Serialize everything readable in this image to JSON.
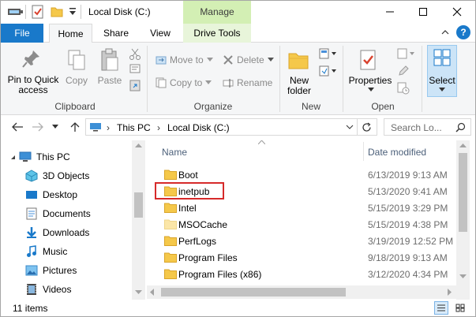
{
  "window": {
    "title": "Local Disk (C:)",
    "context_tab": "Manage",
    "minimize_glyph": "—",
    "maximize_glyph": "☐",
    "close_glyph": "✕"
  },
  "ribbon_tabs": [
    "File",
    "Home",
    "Share",
    "View",
    "Drive Tools"
  ],
  "help_glyph": "?",
  "clipboard": {
    "pin_label_1": "Pin to Quick",
    "pin_label_2": "access",
    "copy": "Copy",
    "paste": "Paste",
    "group": "Clipboard"
  },
  "organize": {
    "move_to": "Move to",
    "copy_to": "Copy to",
    "delete": "Delete",
    "rename": "Rename",
    "group": "Organize"
  },
  "new": {
    "new_folder_1": "New",
    "new_folder_2": "folder",
    "group": "New"
  },
  "open": {
    "properties": "Properties",
    "group": "Open"
  },
  "select": {
    "label": "Select"
  },
  "address": {
    "crumbs": [
      "This PC",
      "Local Disk (C:)"
    ],
    "search_placeholder": "Search Lo..."
  },
  "nav_pane": [
    {
      "label": "This PC",
      "icon": "this-pc-icon"
    },
    {
      "label": "3D Objects",
      "icon": "3d-objects-icon"
    },
    {
      "label": "Desktop",
      "icon": "desktop-icon"
    },
    {
      "label": "Documents",
      "icon": "documents-icon"
    },
    {
      "label": "Downloads",
      "icon": "downloads-icon"
    },
    {
      "label": "Music",
      "icon": "music-icon"
    },
    {
      "label": "Pictures",
      "icon": "pictures-icon"
    },
    {
      "label": "Videos",
      "icon": "videos-icon"
    }
  ],
  "columns": {
    "name": "Name",
    "date_modified": "Date modified"
  },
  "files": [
    {
      "name": "Boot",
      "date": "6/13/2019 9:13 AM",
      "faded": false
    },
    {
      "name": "inetpub",
      "date": "5/13/2020 9:41 AM",
      "faded": false,
      "highlighted": true
    },
    {
      "name": "Intel",
      "date": "5/15/2019 3:29 PM",
      "faded": false
    },
    {
      "name": "MSOCache",
      "date": "5/15/2019 4:38 PM",
      "faded": true
    },
    {
      "name": "PerfLogs",
      "date": "3/19/2019 12:52 PM",
      "faded": false
    },
    {
      "name": "Program Files",
      "date": "9/18/2019 9:13 AM",
      "faded": false
    },
    {
      "name": "Program Files (x86)",
      "date": "3/12/2020 4:34 PM",
      "faded": false
    }
  ],
  "status": {
    "item_count": "11 items"
  },
  "colors": {
    "file_tab": "#1979ca",
    "manage_tab": "#d3efb4",
    "highlight_box": "#d62a2a",
    "folder": "#f5c84a"
  }
}
